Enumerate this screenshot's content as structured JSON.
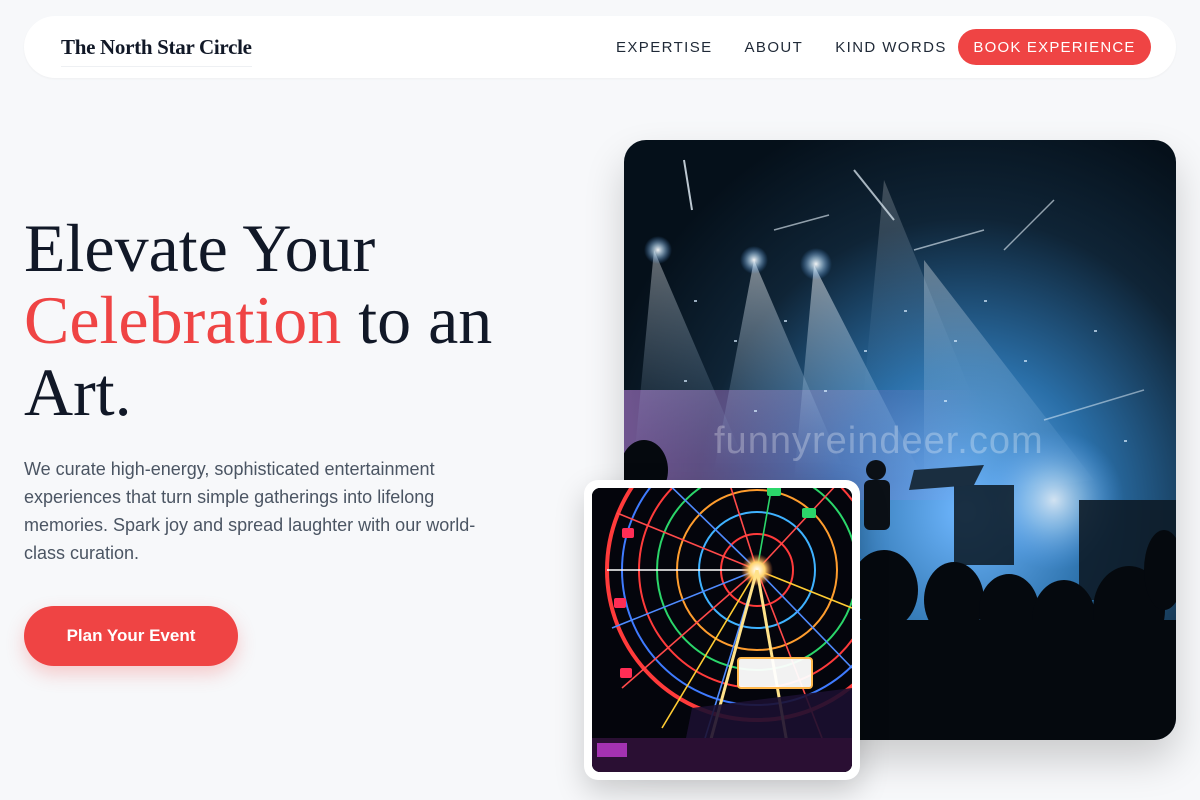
{
  "brand": {
    "name": "The North Star Circle"
  },
  "nav": {
    "links": [
      "EXPERTISE",
      "ABOUT",
      "KIND WORDS"
    ],
    "cta_label": "BOOK EXPERIENCE"
  },
  "hero": {
    "title_line1": "Elevate Your",
    "title_accent": "Celebration",
    "title_line2_rest": " to an",
    "title_line3": "Art.",
    "description": "We curate high-energy, sophisticated entertainment experiences that turn simple gatherings into lifelong memories. Spark joy and spread laughter with our world-class curation.",
    "cta_label": "Plan Your Event"
  },
  "images": {
    "concert_watermark": "funnyreindeer.com",
    "concert_icon": "concert-stage-photo",
    "wheel_icon": "ferris-wheel-photo"
  },
  "colors": {
    "accent": "#ef4444",
    "text_dark": "#111827",
    "text_muted": "#4b5563",
    "background": "#f7f8fa"
  }
}
